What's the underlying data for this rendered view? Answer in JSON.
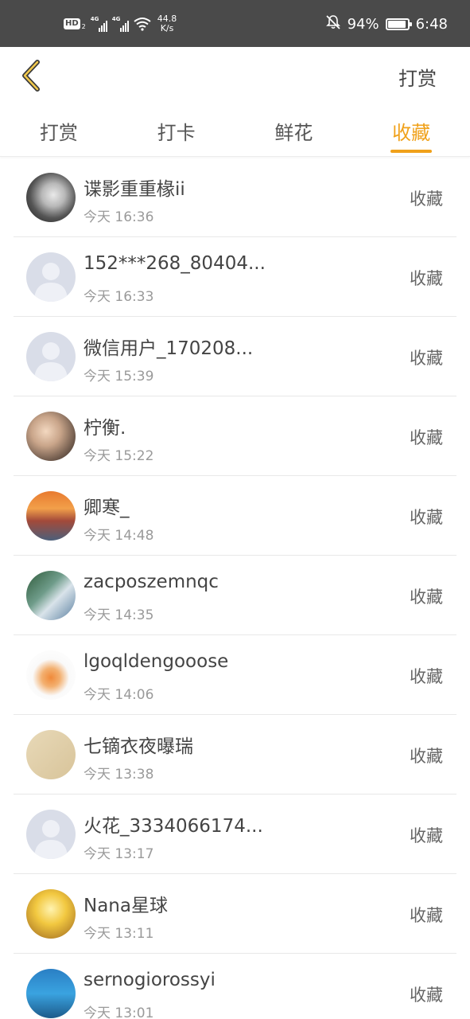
{
  "status_bar": {
    "hd": "HD",
    "hd_sub": "2",
    "sim1": "4G",
    "sim2": "4G",
    "net_speed_value": "44.8",
    "net_speed_unit": "K/s",
    "battery": "94%",
    "battery_level": 0.94,
    "time": "6:48"
  },
  "nav": {
    "back_icon": "chevron-left-icon",
    "action_label": "打赏",
    "accent_color": "#f0a11a"
  },
  "tabs": [
    {
      "label": "打赏",
      "active": false
    },
    {
      "label": "打卡",
      "active": false
    },
    {
      "label": "鲜花",
      "active": false
    },
    {
      "label": "收藏",
      "active": true
    }
  ],
  "list": [
    {
      "name": "谍影重重椽ii",
      "time": "今天 16:36",
      "action": "收藏",
      "avatar": "photo"
    },
    {
      "name": "152***268_80404...",
      "time": "今天 16:33",
      "action": "收藏",
      "avatar": "default-person-icon"
    },
    {
      "name": "微信用户_170208...",
      "time": "今天 15:39",
      "action": "收藏",
      "avatar": "default-person-icon"
    },
    {
      "name": "柠衡.",
      "time": "今天 15:22",
      "action": "收藏",
      "avatar": "photo"
    },
    {
      "name": "卿寒_",
      "time": "今天 14:48",
      "action": "收藏",
      "avatar": "photo"
    },
    {
      "name": "zacposzemnqc",
      "time": "今天 14:35",
      "action": "收藏",
      "avatar": "photo"
    },
    {
      "name": "lgoqldengooose",
      "time": "今天 14:06",
      "action": "收藏",
      "avatar": "photo"
    },
    {
      "name": "七镝衣夜曝瑞",
      "time": "今天 13:38",
      "action": "收藏",
      "avatar": "photo"
    },
    {
      "name": "火花_3334066174...",
      "time": "今天 13:17",
      "action": "收藏",
      "avatar": "default-person-icon"
    },
    {
      "name": "Nana星球",
      "time": "今天 13:11",
      "action": "收藏",
      "avatar": "photo"
    },
    {
      "name": "sernogiorossyi",
      "time": "今天 13:01",
      "action": "收藏",
      "avatar": "photo"
    }
  ]
}
